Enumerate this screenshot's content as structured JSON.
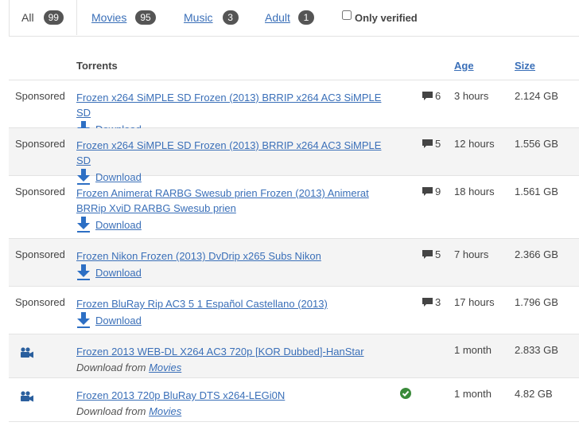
{
  "filters": {
    "all": {
      "label": "All",
      "count": "99"
    },
    "movies": {
      "label": "Movies",
      "count": "95"
    },
    "music": {
      "label": "Music",
      "count": "3"
    },
    "adult": {
      "label": "Adult",
      "count": "1"
    },
    "only_verified": {
      "label": "Only verified",
      "checked": false
    }
  },
  "table": {
    "headers": {
      "torrents": "Torrents",
      "age": "Age",
      "size": "Size"
    },
    "download_label": "Download",
    "download_from": "Download from",
    "rows": [
      {
        "type": "Sponsored",
        "title": "Frozen x264 SiMPLE SD Frozen (2013) BRRIP x264 AC3 SiMPLE SD",
        "comments": "6",
        "age": "3 hours",
        "size": "2.124 GB"
      },
      {
        "type": "Sponsored",
        "title": "Frozen x264 SiMPLE SD Frozen (2013) BRRIP x264 AC3 SiMPLE SD",
        "comments": "5",
        "age": "12 hours",
        "size": "1.556 GB"
      },
      {
        "type": "Sponsored",
        "title": "Frozen Animerat RARBG Swesub prien Frozen (2013) Animerat BRRip XviD RARBG Swesub prien",
        "comments": "9",
        "age": "18 hours",
        "size": "1.561 GB"
      },
      {
        "type": "Sponsored",
        "title": "Frozen Nikon Frozen (2013) DvDrip x265 Subs Nikon",
        "comments": "5",
        "age": "7 hours",
        "size": "2.366 GB"
      },
      {
        "type": "Sponsored",
        "title": "Frozen BluRay Rip AC3 5 1 Español Castellano (2013)",
        "comments": "3",
        "age": "17 hours",
        "size": "1.796 GB"
      },
      {
        "type": "movie-camera-icon",
        "title": "Frozen 2013 WEB-DL X264 AC3 720p [KOR Dubbed]-HanStar",
        "source": "Movies",
        "age": "1 month",
        "size": "2.833 GB"
      },
      {
        "type": "movie-camera-icon",
        "title": "Frozen 2013 720p BluRay DTS x264-LEGi0N",
        "source": "Movies",
        "verified": true,
        "age": "1 month",
        "size": "4.82 GB"
      }
    ]
  },
  "colors": {
    "link": "#3a6fb8",
    "badge": "#555555",
    "download_arrow": "#2d6fc4",
    "verified_check": "#3a8a3a",
    "camera": "#2a5f9e"
  }
}
